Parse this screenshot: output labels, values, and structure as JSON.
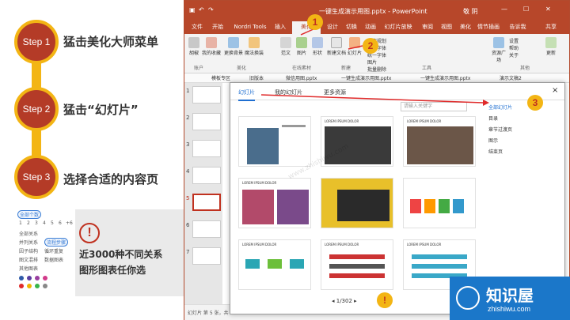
{
  "steps": [
    {
      "label": "Step 1",
      "text": "猛击美化大师菜单"
    },
    {
      "label": "Step 2",
      "text": "猛击“幻灯片”"
    },
    {
      "label": "Step 3",
      "text": "选择合适的内容页"
    }
  ],
  "options": {
    "all_count": "全部个数",
    "counts": [
      "1",
      "2",
      "3",
      "4",
      "5",
      "6",
      "+6"
    ],
    "rows": [
      [
        "全部关系"
      ],
      [
        "并列关系",
        "流程步骤"
      ],
      [
        "因子结构",
        "循环重复"
      ],
      [
        "图文混排",
        "数据图表"
      ],
      [
        "其他图表"
      ]
    ],
    "colors": [
      "#2f5aa8",
      "#5a3fa0",
      "#9a3fa0",
      "#d23a8a",
      "#e02a2a",
      "#f0b400",
      "#3ab54a",
      "#888888"
    ]
  },
  "info": {
    "icon": "!",
    "line1": "近3000种不同关系",
    "line2": "图形图表任你选"
  },
  "app": {
    "title": "一键生成演示用图.pptx - PowerPoint",
    "user": "敬 阴",
    "tabs": [
      "文件",
      "开始",
      "Nordri Tools",
      "插入",
      "美化",
      "设计",
      "切换",
      "动画",
      "幻灯片放映",
      "审阅",
      "视图",
      "美化",
      "情节插画",
      "告诉我",
      "共享"
    ],
    "ribbon": {
      "buttons": [
        "胡椒",
        "我的收藏",
        "更换背景",
        "魔法换装",
        "范文",
        "图片",
        "形状",
        "新建文档",
        "幻灯片",
        "资源广场",
        "更新"
      ],
      "small": [
        "内容规划",
        "替换字体",
        "统一字体",
        "图片",
        "批量删除",
        "设置",
        "帮助",
        "关于"
      ],
      "groups": [
        "账户",
        "美化",
        "在线素材",
        "新建",
        "工具",
        "其他"
      ]
    },
    "doc_tabs": [
      "模板专区",
      "旧版本",
      "微信用图.pptx",
      "一键生成演示用图.pptx",
      "一键生成演示用图.pptx",
      "演示文稿2"
    ],
    "slide_numbers": [
      "1",
      "2",
      "3",
      "4",
      "5",
      "6",
      "7"
    ],
    "status": "幻灯片 第 5 张，共"
  },
  "dialog": {
    "tabs": [
      "幻灯片",
      "我的幻灯片",
      "更多资源"
    ],
    "search_placeholder": "请输入关键字",
    "card_title": "LOREM IPSUM DOLOR",
    "categories": [
      "全部幻灯片",
      "目录",
      "章节过渡页",
      "图示",
      "结束页"
    ],
    "pager": "1/302"
  },
  "markers": [
    "1",
    "2",
    "3",
    "!"
  ],
  "watermark": "www.zhishiwu.com",
  "logo": {
    "cn": "知识屋",
    "en": "zhishiwu.com"
  }
}
